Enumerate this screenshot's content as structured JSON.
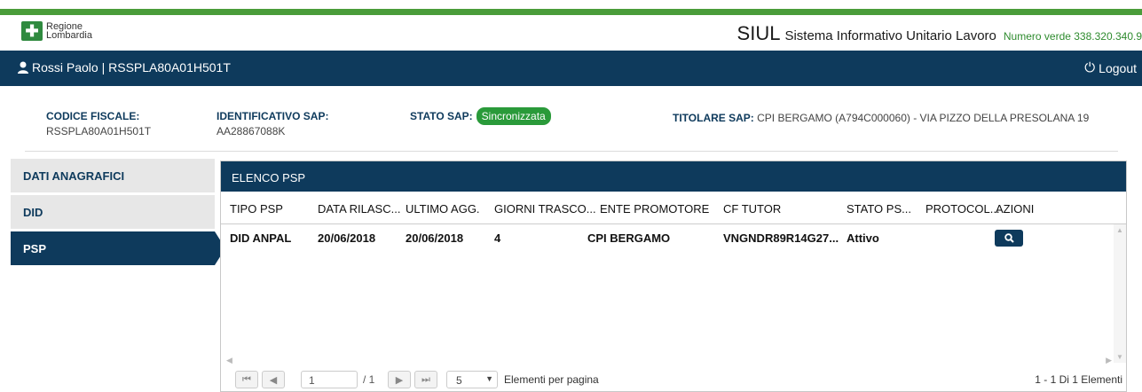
{
  "brand": {
    "line1": "Regione",
    "line2": "Lombardia"
  },
  "header": {
    "title_short": "SIUL",
    "title_long": "Sistema Informativo Unitario Lavoro",
    "numero_verde": "Numero verde 338.320.340.9"
  },
  "userbar": {
    "user": "Rossi Paolo | RSSPLA80A01H501T",
    "logout": "Logout"
  },
  "info": {
    "cf_label": "CODICE FISCALE:",
    "cf_value": "RSSPLA80A01H501T",
    "sap_label": "IDENTIFICATIVO SAP:",
    "sap_value": "AA28867088K",
    "stato_label": "STATO SAP:",
    "stato_value": "Sincronizzata",
    "titolare_label": "TITOLARE SAP:",
    "titolare_value": "CPI BERGAMO (A794C000060) - VIA PIZZO DELLA PRESOLANA 19"
  },
  "sidebar": {
    "items": [
      {
        "label": "DATI ANAGRAFICI"
      },
      {
        "label": "DID"
      },
      {
        "label": "PSP"
      }
    ],
    "active": "PSP"
  },
  "panel": {
    "title": "ELENCO PSP"
  },
  "table": {
    "columns": [
      "TIPO PSP",
      "DATA RILASC...",
      "ULTIMO AGG.",
      "GIORNI TRASCO...",
      "ENTE PROMOTORE",
      "CF TUTOR",
      "STATO PS...",
      "PROTOCOL...",
      "AZIONI"
    ],
    "rows": [
      [
        "DID ANPAL",
        "20/06/2018",
        "20/06/2018",
        "4",
        "CPI BERGAMO",
        "VNGNDR89R14G27...",
        "Attivo",
        "",
        "search-icon"
      ]
    ]
  },
  "pager": {
    "page": "1",
    "of": "/ 1",
    "page_size": "5",
    "page_size_label": "Elementi per pagina",
    "summary": "1 - 1 Di 1 Elementi"
  },
  "colors": {
    "navy": "#0e3a5c",
    "green": "#4a9c3a",
    "badge": "#2a9a3a"
  }
}
